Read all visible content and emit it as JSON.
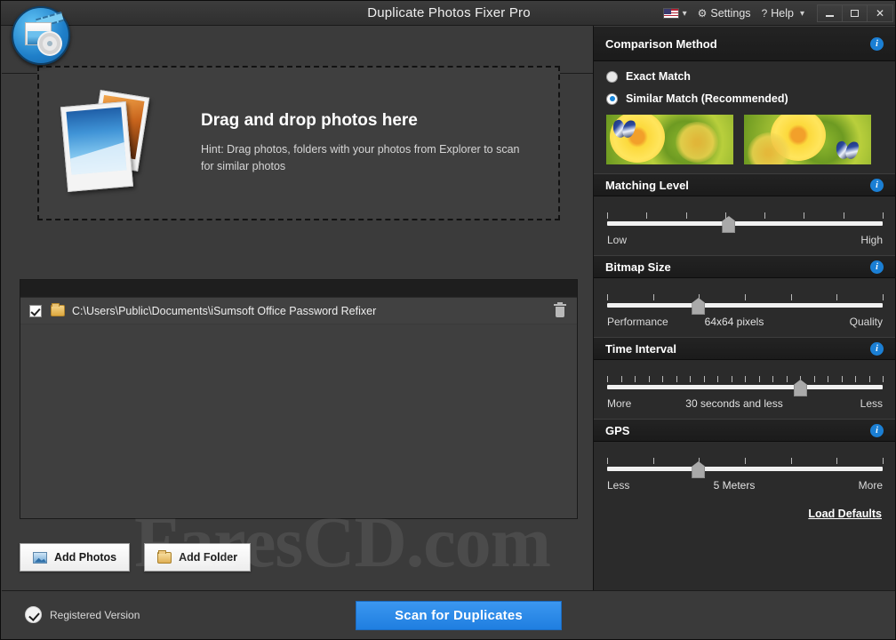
{
  "window": {
    "title": "Duplicate Photos Fixer Pro",
    "app_icon": "photo-gear-icon",
    "language_flag": "us-flag-icon",
    "settings_label": "Settings",
    "settings_icon": "gear-icon",
    "help_label": "Help",
    "help_icon": "question-mark-icon",
    "minimize_label": "Minimize",
    "maximize_label": "Maximize",
    "close_label": "✕",
    "accent_color": "#2c8ae8"
  },
  "dropzone": {
    "title": "Drag and drop photos here",
    "hint": "Hint: Drag photos, folders with your photos from Explorer to scan for similar photos"
  },
  "file_list": {
    "rows": [
      {
        "checked": true,
        "icon": "folder-icon",
        "path": "C:\\Users\\Public\\Documents\\iSumsoft Office Password Refixer",
        "delete_icon": "trash-icon"
      }
    ]
  },
  "actions": {
    "add_photos": "Add Photos",
    "add_photos_icon": "image-icon",
    "add_folder": "Add Folder",
    "add_folder_icon": "folder-icon"
  },
  "comparison": {
    "heading": "Comparison Method",
    "info_icon": "info-icon",
    "options": [
      {
        "label": "Exact Match",
        "selected": false
      },
      {
        "label": "Similar Match (Recommended)",
        "selected": true
      }
    ],
    "sample_thumbnails": [
      "sunflower-butterfly-left",
      "sunflower-butterfly-right"
    ]
  },
  "sliders": [
    {
      "heading": "Matching Level",
      "info_icon": "info-icon",
      "min_label": "Low",
      "max_label": "High",
      "value_label": "",
      "ticks": 8,
      "position_pct": 44
    },
    {
      "heading": "Bitmap Size",
      "info_icon": "info-icon",
      "min_label": "Performance",
      "max_label": "Quality",
      "value_label": "64x64 pixels",
      "ticks": 7,
      "position_pct": 33
    },
    {
      "heading": "Time Interval",
      "info_icon": "info-icon",
      "min_label": "More",
      "max_label": "Less",
      "value_label": "30 seconds and less",
      "ticks": 21,
      "position_pct": 70
    },
    {
      "heading": "GPS",
      "info_icon": "info-icon",
      "min_label": "Less",
      "max_label": "More",
      "value_label": "5 Meters",
      "ticks": 7,
      "position_pct": 33
    }
  ],
  "load_defaults": "Load Defaults",
  "status": {
    "registered": "Registered Version",
    "registered_icon": "check-circle-icon",
    "scan_button": "Scan for Duplicates"
  },
  "watermark": "FaresCD.com"
}
